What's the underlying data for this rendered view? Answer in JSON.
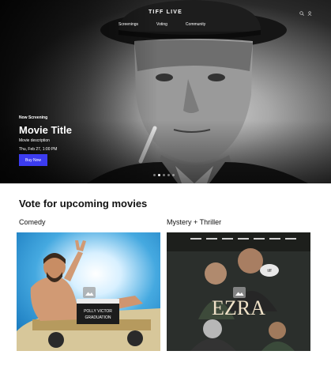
{
  "nav": {
    "brand": "TIFF LIVE",
    "links": [
      "Screenings",
      "Voting",
      "Community"
    ],
    "icons": [
      "search-icon",
      "user-icon"
    ]
  },
  "hero": {
    "eyebrow": "Now Screening",
    "title": "Movie Title",
    "description": "Movie description",
    "datetime": "Thu, Feb 27, 1:00 PM",
    "button_label": "Buy Now",
    "slides_count": 5,
    "active_slide": 1
  },
  "vote": {
    "heading": "Vote for upcoming movies",
    "categories": [
      {
        "label": "Comedy",
        "poster_text": [
          "POLLY VICTOR",
          "GRADUATION"
        ]
      },
      {
        "label": "Mystery + Thriller",
        "poster_title": "EZRA",
        "poster_small": "tiff"
      }
    ]
  },
  "colors": {
    "accent": "#3c3cf0"
  }
}
